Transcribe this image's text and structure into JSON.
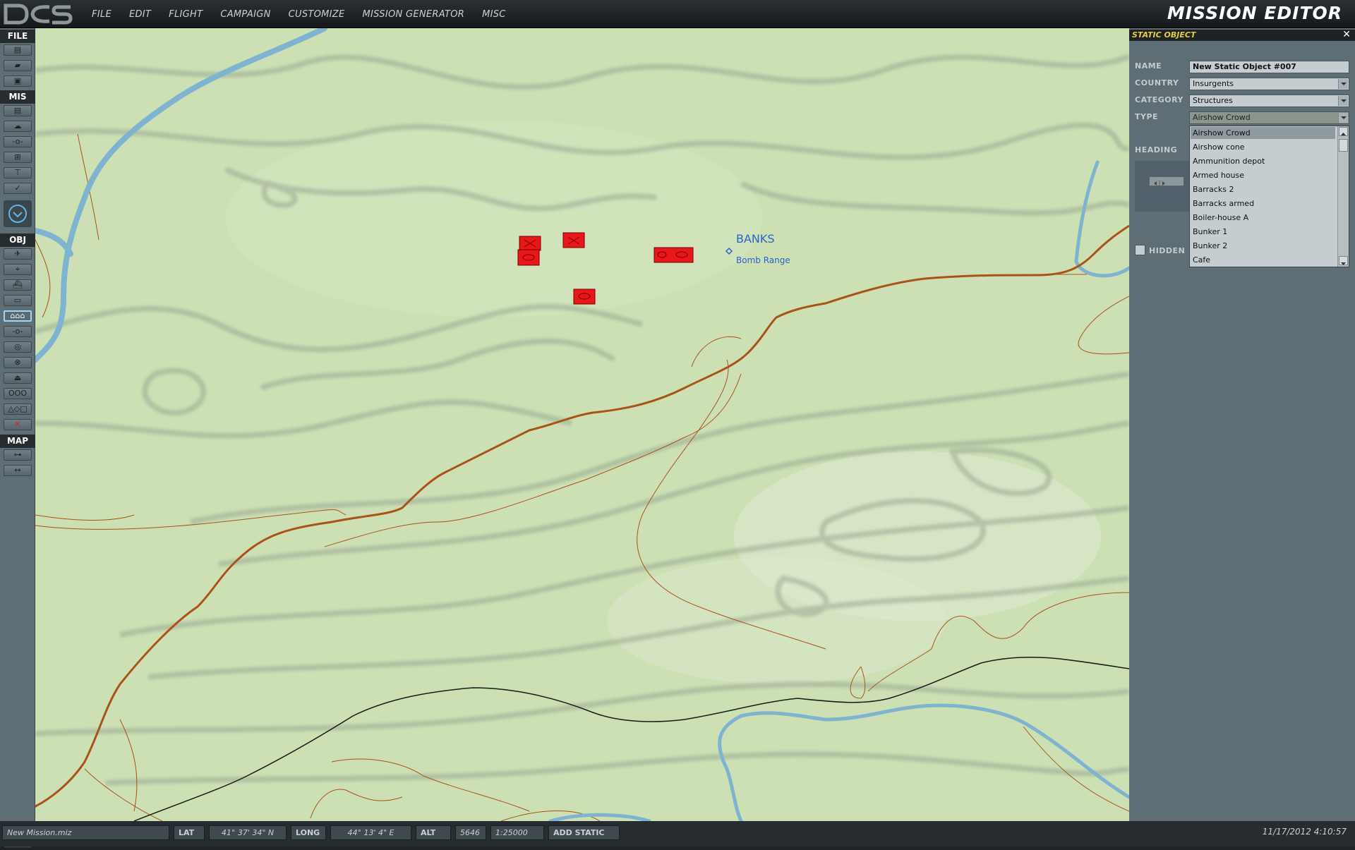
{
  "app": {
    "logo_text": "DCS",
    "title": "MISSION EDITOR",
    "menu": [
      "FILE",
      "EDIT",
      "FLIGHT",
      "CAMPAIGN",
      "CUSTOMIZE",
      "MISSION GENERATOR",
      "MISC"
    ]
  },
  "toolbar": {
    "sections": {
      "file": "FILE",
      "mis": "MIS",
      "obj": "OBJ",
      "map": "MAP"
    },
    "active_tool": "static-objects"
  },
  "map": {
    "label_main": "BANKS",
    "label_sub": "Bomb Range",
    "colors": {
      "terrain": "#cde0b4",
      "river": "#7fb4d0",
      "road": "#a9531a",
      "contour": "#8c9a82",
      "rail": "#1a1a1a",
      "unit": "#e8171a"
    }
  },
  "panel": {
    "title": "STATIC OBJECT",
    "labels": {
      "name": "NAME",
      "country": "COUNTRY",
      "category": "CATEGORY",
      "type": "TYPE",
      "heading": "HEADING",
      "hidden": "HIDDEN"
    },
    "name_value": "New Static Object #007",
    "country_value": "Insurgents",
    "category_value": "Structures",
    "type_value": "Airshow Crowd",
    "type_options": [
      "Airshow Crowd",
      "Airshow cone",
      "Ammunition depot",
      "Armed house",
      "Barracks 2",
      "Barracks armed",
      "Boiler-house A",
      "Bunker 1",
      "Bunker 2",
      "Cafe"
    ],
    "hidden_checked": false
  },
  "statusbar": {
    "filename": "New Mission.miz",
    "lat_label": "LAT",
    "lat_value": "41° 37' 34\" N",
    "long_label": "LONG",
    "long_value": "44° 13' 4\" E",
    "alt_label": "ALT",
    "alt_value": "5646",
    "scale": "1:25000",
    "mode": "ADD STATIC",
    "datetime": "11/17/2012 4:10:57"
  }
}
